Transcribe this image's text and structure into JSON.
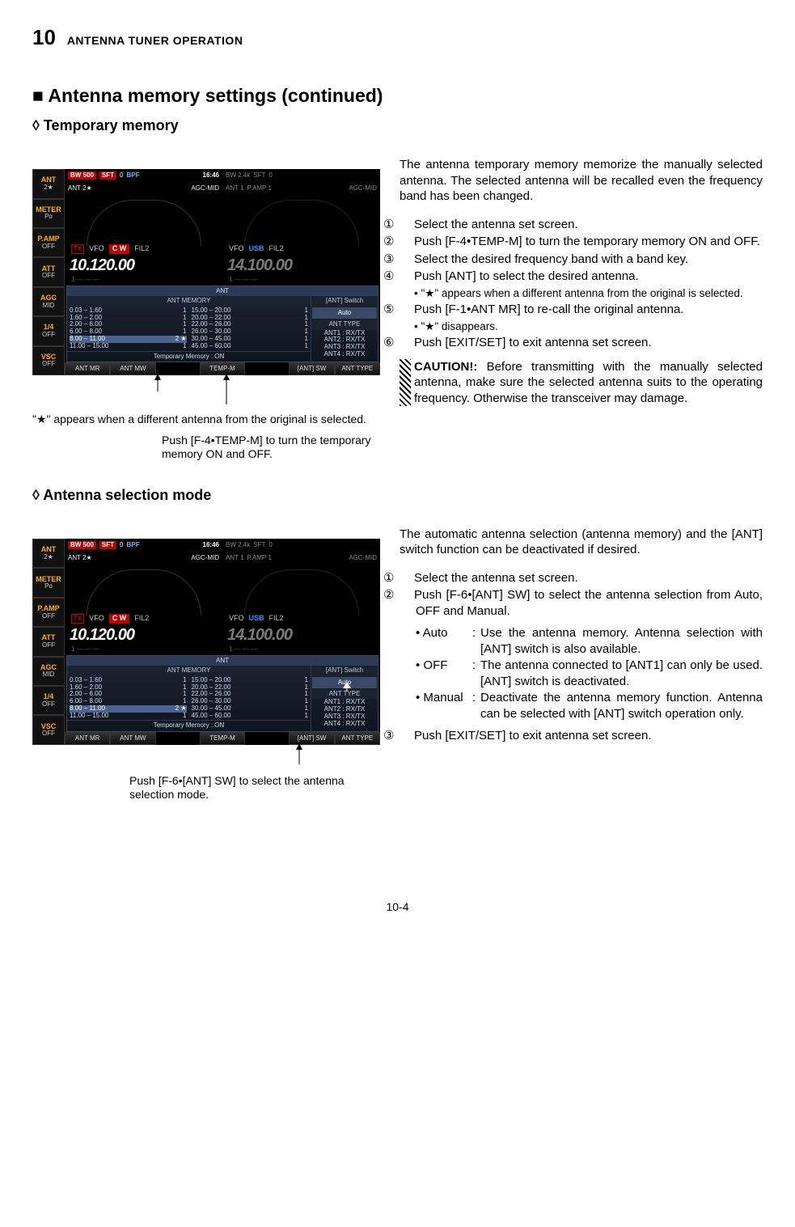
{
  "page": {
    "chapter_num": "10",
    "chapter_title": "ANTENNA TUNER OPERATION",
    "footer": "10-4"
  },
  "section": {
    "title": "■  Antenna memory settings (continued)"
  },
  "temp": {
    "title": "◊ Temporary memory",
    "caption_star": "\"★\" appears when a different antenna from the original is selected.",
    "caption_push": "Push [F-4•TEMP-M] to turn the temporary memory ON and OFF.",
    "intro": "The antenna temporary memory memorize the manually selected antenna. The selected antenna will be recalled even the frequency band has been changed.",
    "steps": {
      "s1": "Select the antenna set screen.",
      "s2": "Push [F-4•TEMP-M] to turn the temporary memory ON and OFF.",
      "s3": "Select the desired frequency band with a band key.",
      "s4": "Push [ANT] to select the desired antenna.",
      "s4_note": "• \"★\" appears when a different antenna from the original is selected.",
      "s5": "Push [F-1•ANT MR] to re-call the original antenna.",
      "s5_note": "• \"★\" disappears.",
      "s6": "Push [EXIT/SET] to exit antenna set screen."
    },
    "caution_bold": "CAUTION!:",
    "caution": " Before transmitting with the manually selected antenna, make sure the selected antenna suits to the operating frequency. Otherwise the transceiver may damage."
  },
  "sel": {
    "title": "◊ Antenna selection mode",
    "caption_push": "Push [F-6•[ANT] SW] to select the antenna selection mode.",
    "intro": "The automatic antenna selection (antenna memory) and the [ANT] switch function can be deactivated if desired.",
    "steps": {
      "s1": "Select the antenna set screen.",
      "s2": "Push [F-6•[ANT] SW] to select the antenna selection from Auto, OFF and Manual.",
      "auto_label": "• Auto",
      "auto_text": "Use the antenna memory. Antenna selection with [ANT] switch is also available.",
      "off_label": "• OFF",
      "off_text": "The antenna connected to [ANT1] can only be used. [ANT] switch is deactivated.",
      "man_label": "• Manual",
      "man_text": "Deactivate the antenna memory function. Antenna can be selected with [ANT] switch operation only.",
      "s3": "Push [EXIT/SET] to exit antenna set screen."
    }
  },
  "circled": {
    "1": "①",
    "2": "②",
    "3": "③",
    "4": "④",
    "5": "⑤",
    "6": "⑥"
  },
  "radio": {
    "side": [
      {
        "l1": "ANT",
        "l2": "2★"
      },
      {
        "l1": "METER",
        "l2": "Po"
      },
      {
        "l1": "P.AMP",
        "l2": "OFF"
      },
      {
        "l1": "ATT",
        "l2": "OFF"
      },
      {
        "l1": "AGC",
        "l2": "MID"
      },
      {
        "l1": "1/4",
        "l2": "OFF"
      },
      {
        "l1": "VSC",
        "l2": "OFF"
      }
    ],
    "top": {
      "l_bw": "BW 500",
      "l_sft": "SFT",
      "l_zero": "0",
      "l_bpf": "BPF",
      "clock": "16:46",
      "r_bw": "BW 2.4k",
      "r_sft": "SFT",
      "r_zero": "0",
      "l_ant": "ANT 2★",
      "l_agc": "AGC-MID",
      "r_ant": "ANT 1",
      "r_pamp": "P.AMP 1",
      "r_agc": "AGC-MID"
    },
    "row1": {
      "tx": "TX",
      "vfo": "VFO",
      "cw": "C W",
      "usb": "USB",
      "fil": "FIL2"
    },
    "freq": {
      "left": "10.120.00",
      "right": "14.100.00"
    },
    "sub": {
      "left": "1 --- --- ---",
      "right": "1 --- --- ---"
    },
    "ant": {
      "title": "ANT",
      "mem_hdr": "ANT  MEMORY",
      "left_rows": [
        {
          "rng": "0.03  –   1.60",
          "a": "1"
        },
        {
          "rng": "1.60  –   2.00",
          "a": "1"
        },
        {
          "rng": "2.00  –   6.00",
          "a": "1"
        },
        {
          "rng": "6.00  –   8.00",
          "a": "1"
        },
        {
          "rng": "8.00  – 11.00",
          "a": "2",
          "star": "★",
          "sel": true
        },
        {
          "rng": "11.00 – 15.00",
          "a": "1"
        }
      ],
      "right_rows": [
        {
          "rng": "15.00 – 20.00",
          "a": "1"
        },
        {
          "rng": "20.00 – 22.00",
          "a": "1"
        },
        {
          "rng": "22.00 – 26.00",
          "a": "1"
        },
        {
          "rng": "26.00 – 30.00",
          "a": "1"
        },
        {
          "rng": "30.00 – 45.00",
          "a": "1"
        },
        {
          "rng": "45.00 – 60.00",
          "a": "1"
        }
      ],
      "sw_hdr": "[ANT]  Switch",
      "sw_val": "Auto",
      "type_hdr": "ANT  TYPE",
      "types": [
        "ANT1 : RX/TX",
        "ANT2 : RX/TX",
        "ANT3 : RX/TX",
        "ANT4 : RX/TX"
      ],
      "temp": "Temporary  Memory   :   ON"
    },
    "fkeys": [
      "ANT  MR",
      "ANT  MW",
      "",
      "TEMP-M",
      "",
      "[ANT]  SW",
      "ANT  TYPE"
    ]
  }
}
